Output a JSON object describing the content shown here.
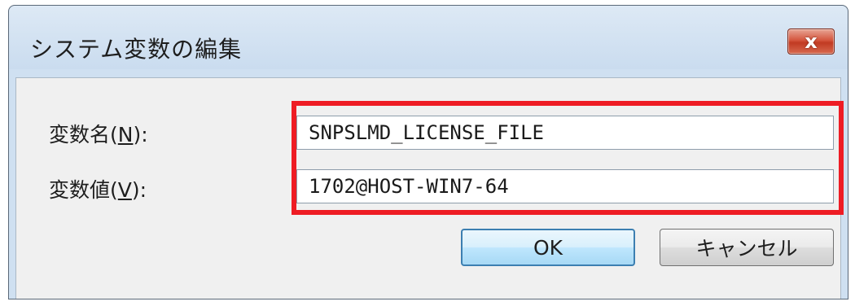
{
  "window": {
    "title": "システム変数の編集",
    "close_label": "x"
  },
  "form": {
    "name_label_prefix": "変数名(",
    "name_label_accel": "N",
    "name_label_suffix": "):",
    "value_label_prefix": "変数値(",
    "value_label_accel": "V",
    "value_label_suffix": "):",
    "name_value": "SNPSLMD_LICENSE_FILE",
    "value_value": "1702@HOST-WIN7-64"
  },
  "buttons": {
    "ok_label": "OK",
    "cancel_label": "キャンセル"
  },
  "colors": {
    "highlight": "#ee1c24",
    "close_button": "#c13a22",
    "title_bar": "#cfe0f1"
  }
}
